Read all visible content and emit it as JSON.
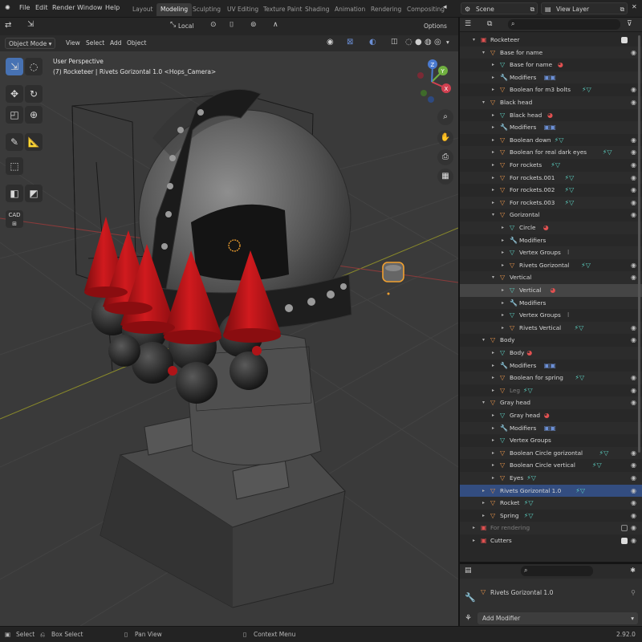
{
  "menu": [
    "File",
    "Edit",
    "Render",
    "Window",
    "Help"
  ],
  "workspaces": [
    {
      "label": "Layout",
      "active": false
    },
    {
      "label": "Modeling",
      "active": true
    },
    {
      "label": "Sculpting",
      "active": false
    },
    {
      "label": "UV Editing",
      "active": false
    },
    {
      "label": "Texture Paint",
      "active": false
    },
    {
      "label": "Shading",
      "active": false
    },
    {
      "label": "Animation",
      "active": false
    },
    {
      "label": "Rendering",
      "active": false
    },
    {
      "label": "Compositing",
      "active": false
    }
  ],
  "scene": {
    "name": "Scene",
    "view_layer": "View Layer"
  },
  "viewport": {
    "mode": "Object Mode",
    "menus": [
      "View",
      "Select",
      "Add",
      "Object"
    ],
    "transform_orientation": "Local",
    "options": "Options",
    "perspective": "User Perspective",
    "context": "(7) Rocketeer | Rivets Gorizontal 1.0 <Hops_Camera>",
    "tool_cad_label": "CAD",
    "gizmo_axes": [
      "X",
      "Y",
      "Z"
    ]
  },
  "colors": {
    "selection": "#334d80",
    "active_tool": "#4772b3",
    "modifier_icon": "#6b8fd6",
    "object_icon": "#e8944a",
    "mesh_icon": "#5ccfc0",
    "material_icon": "#e05050",
    "cone_red": "#c0151a",
    "highlight_orange": "#f0a030"
  },
  "outliner": {
    "rows": [
      {
        "label": "Rocketeer",
        "d": 1,
        "icon": "collection",
        "open": true,
        "eye": false,
        "check": true
      },
      {
        "label": "Base for name",
        "d": 2,
        "icon": "object",
        "open": true,
        "eye": true
      },
      {
        "label": "Base for name",
        "d": 3,
        "icon": "mesh",
        "extra": "material"
      },
      {
        "label": "Modifiers",
        "d": 3,
        "icon": "wrench",
        "extra": "modifiers"
      },
      {
        "label": "Boolean for m3 bolts",
        "d": 3,
        "icon": "object",
        "extra": "mesh",
        "eye": true
      },
      {
        "label": "Black head",
        "d": 2,
        "icon": "object",
        "open": true,
        "eye": true
      },
      {
        "label": "Black head",
        "d": 3,
        "icon": "mesh",
        "extra": "material"
      },
      {
        "label": "Modifiers",
        "d": 3,
        "icon": "wrench",
        "extra": "modifiers"
      },
      {
        "label": "Boolean down",
        "d": 3,
        "icon": "object",
        "extra": "mesh",
        "eye": true
      },
      {
        "label": "Boolean for real dark eyes",
        "d": 3,
        "icon": "object",
        "extra": "mesh",
        "eye": true
      },
      {
        "label": "For rockets",
        "d": 3,
        "icon": "object",
        "extra": "mesh",
        "eye": true
      },
      {
        "label": "For rockets.001",
        "d": 3,
        "icon": "object",
        "extra": "mesh",
        "eye": true
      },
      {
        "label": "For rockets.002",
        "d": 3,
        "icon": "object",
        "extra": "mesh",
        "eye": true
      },
      {
        "label": "For rockets.003",
        "d": 3,
        "icon": "object",
        "extra": "mesh",
        "eye": true
      },
      {
        "label": "Gorizontal",
        "d": 3,
        "icon": "object",
        "open": true,
        "eye": true
      },
      {
        "label": "Circle",
        "d": 4,
        "icon": "mesh",
        "extra": "material"
      },
      {
        "label": "Modifiers",
        "d": 4,
        "icon": "wrench"
      },
      {
        "label": "Vertex Groups",
        "d": 4,
        "icon": "mesh",
        "extra": "groups"
      },
      {
        "label": "Rivets Gorizontal",
        "d": 4,
        "icon": "object",
        "extra": "mesh",
        "eye": true
      },
      {
        "label": "Vertical",
        "d": 3,
        "icon": "object",
        "open": true,
        "eye": true
      },
      {
        "label": "Vertical",
        "d": 4,
        "icon": "mesh",
        "extra": "material",
        "hover": true
      },
      {
        "label": "Modifiers",
        "d": 4,
        "icon": "wrench"
      },
      {
        "label": "Vertex Groups",
        "d": 4,
        "icon": "mesh",
        "extra": "groups"
      },
      {
        "label": "Rivets Vertical",
        "d": 4,
        "icon": "object",
        "extra": "mesh",
        "eye": true
      },
      {
        "label": "Body",
        "d": 2,
        "icon": "object",
        "open": true,
        "eye": true
      },
      {
        "label": "Body",
        "d": 3,
        "icon": "mesh",
        "extra": "material"
      },
      {
        "label": "Modifiers",
        "d": 3,
        "icon": "wrench",
        "extra": "modifiers"
      },
      {
        "label": "Boolean for spring",
        "d": 3,
        "icon": "object",
        "extra": "mesh",
        "eye": true
      },
      {
        "label": "Leg",
        "d": 3,
        "icon": "object",
        "extra": "mesh",
        "eye": true,
        "dim": true
      },
      {
        "label": "Gray head",
        "d": 2,
        "icon": "object",
        "open": true,
        "eye": true
      },
      {
        "label": "Gray head",
        "d": 3,
        "icon": "mesh",
        "extra": "material"
      },
      {
        "label": "Modifiers",
        "d": 3,
        "icon": "wrench",
        "extra": "modifiers"
      },
      {
        "label": "Vertex Groups",
        "d": 3,
        "icon": "mesh"
      },
      {
        "label": "Boolean Circle gorizontal",
        "d": 3,
        "icon": "object",
        "extra": "mesh",
        "eye": true
      },
      {
        "label": "Boolean Circle vertical",
        "d": 3,
        "icon": "object",
        "extra": "mesh",
        "eye": true
      },
      {
        "label": "Eyes",
        "d": 3,
        "icon": "object",
        "extra": "mesh",
        "eye": true
      },
      {
        "label": "Rivets Gorizontal 1.0",
        "d": 2,
        "icon": "object",
        "extra": "mesh",
        "eye": true,
        "selected": true
      },
      {
        "label": "Rocket",
        "d": 2,
        "icon": "object",
        "extra": "mesh",
        "eye": true
      },
      {
        "label": "Spring",
        "d": 2,
        "icon": "object",
        "extra": "mesh",
        "eye": true
      },
      {
        "label": "For rendering",
        "d": 1,
        "icon": "collection",
        "dim": true,
        "check": true,
        "check_off": true,
        "eye": true
      },
      {
        "label": "Cutters",
        "d": 1,
        "icon": "collection",
        "check": true,
        "eye": true
      }
    ]
  },
  "properties": {
    "object_name": "Rivets Gorizontal 1.0",
    "add_modifier": "Add Modifier"
  },
  "statusbar": {
    "select": "Select",
    "box_select": "Box Select",
    "pan_view": "Pan View",
    "context_menu": "Context Menu",
    "version": "2.92.0"
  }
}
